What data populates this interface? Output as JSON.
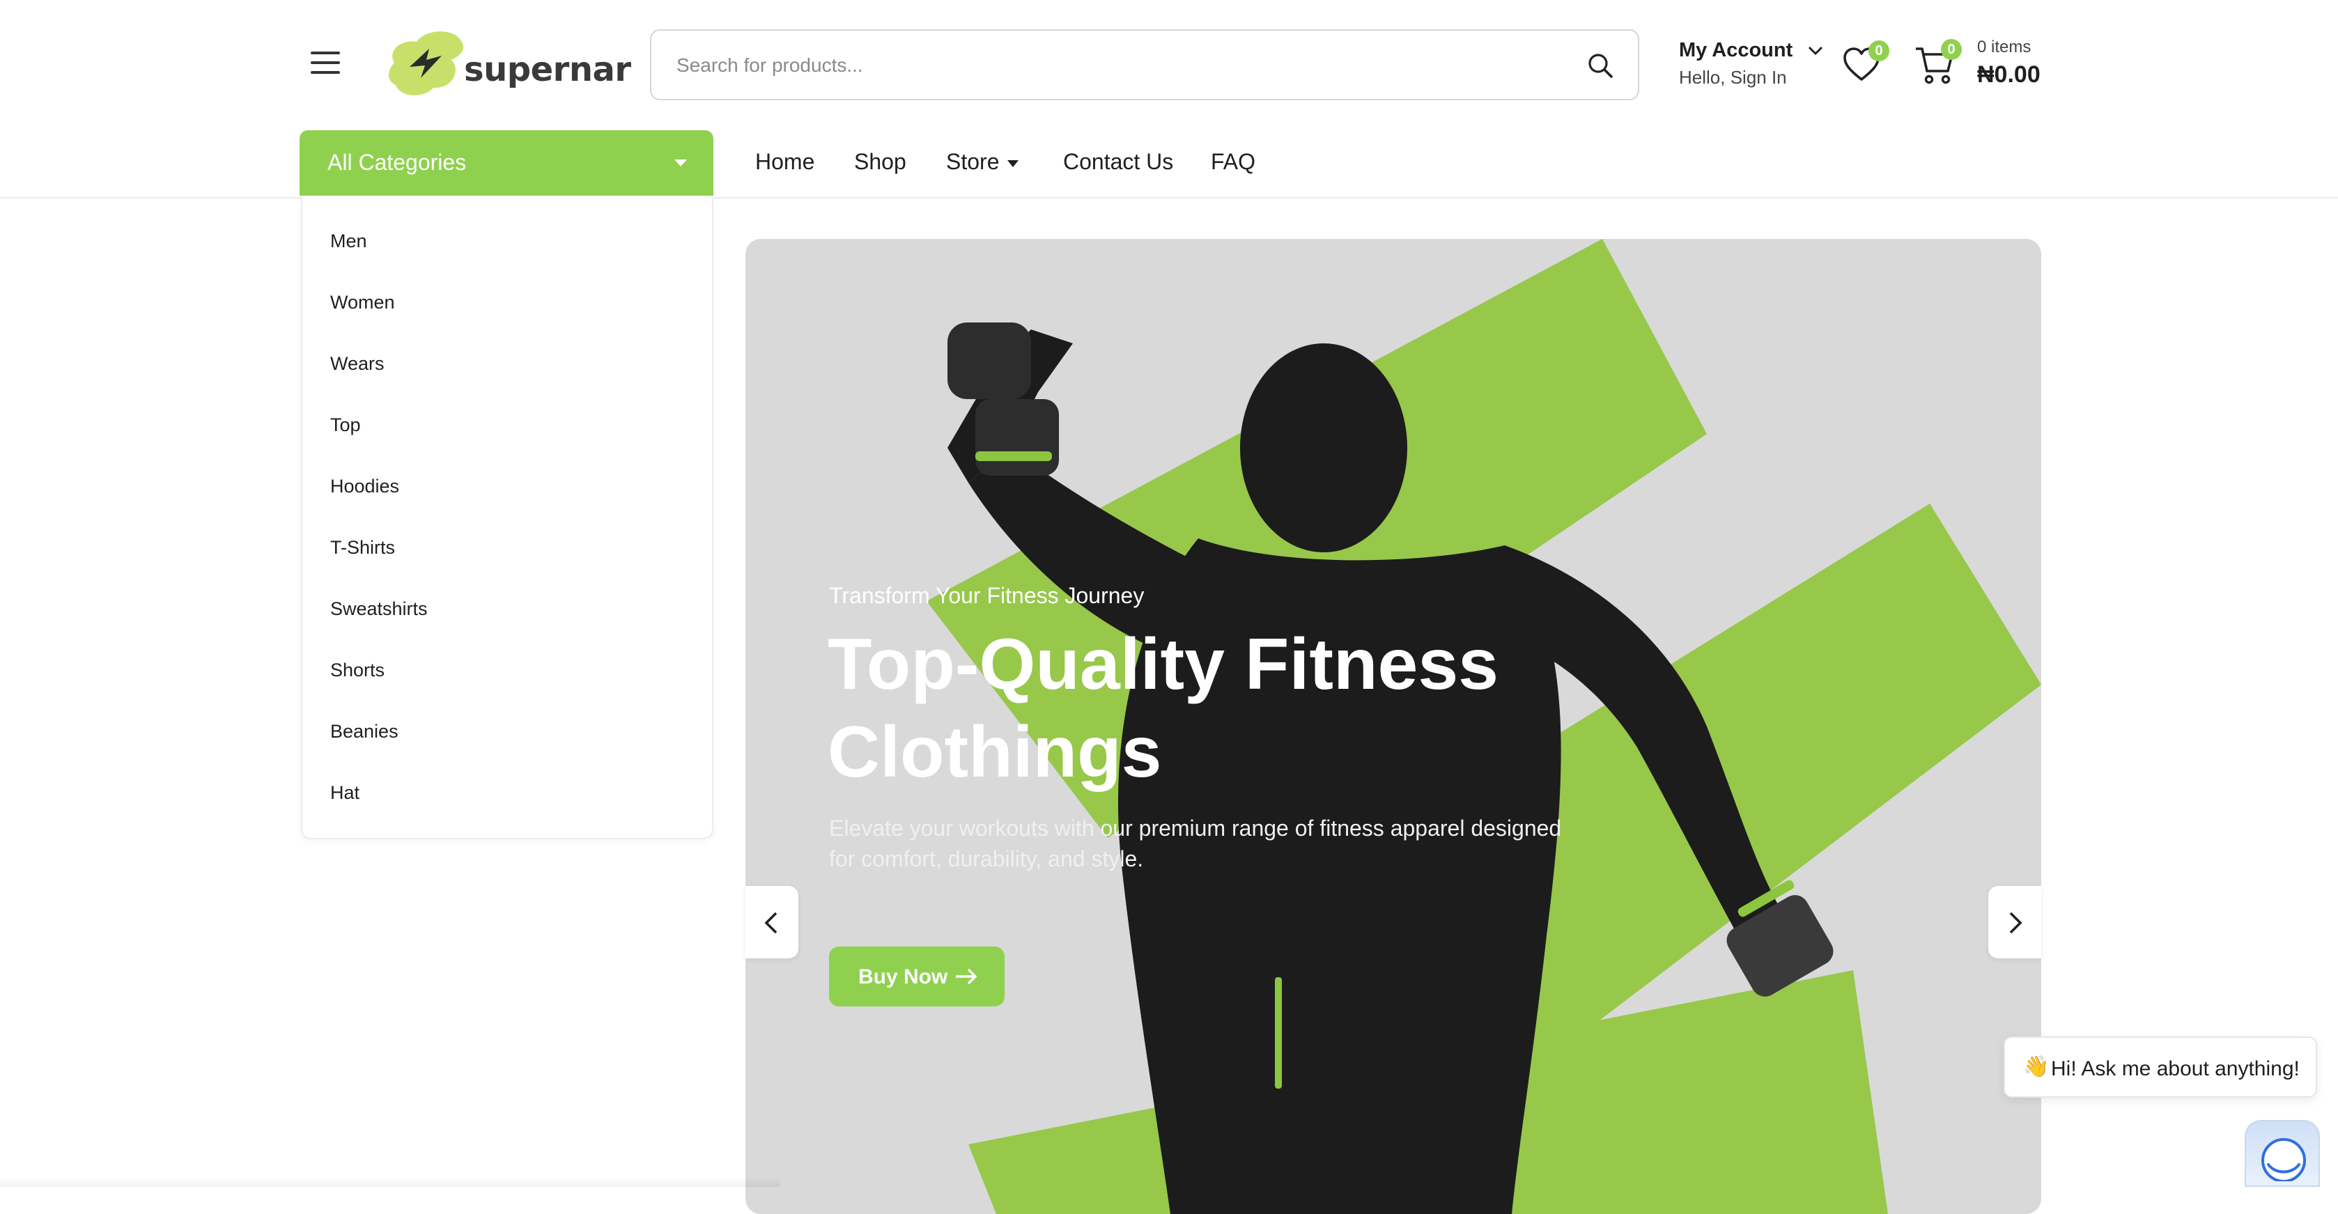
{
  "brand": {
    "name": "supernar",
    "accent": "#8fd14f"
  },
  "search": {
    "placeholder": "Search for products...",
    "icon": "search-icon"
  },
  "account": {
    "title": "My Account",
    "subtitle": "Hello, Sign In"
  },
  "wishlist": {
    "count": "0"
  },
  "cart": {
    "count": "0",
    "items_label": "0 items",
    "total": "₦0.00"
  },
  "nav": {
    "all_categories": "All Categories",
    "links": [
      {
        "label": "Home"
      },
      {
        "label": "Shop"
      },
      {
        "label": "Store"
      },
      {
        "label": "Contact Us"
      },
      {
        "label": "FAQ"
      }
    ]
  },
  "categories": [
    "Men",
    "Women",
    "Wears",
    "Top",
    "Hoodies",
    "T-Shirts",
    "Sweatshirts",
    "Shorts",
    "Beanies",
    "Hat"
  ],
  "hero": {
    "kicker": "Transform Your Fitness Journey",
    "title": "Top-Quality Fitness Clothings",
    "description": "Elevate your workouts with our premium range of fitness apparel designed for comfort, durability, and style.",
    "button": "Buy Now"
  },
  "chat": {
    "emoji": "👋",
    "message": "Hi! Ask me about anything!"
  }
}
